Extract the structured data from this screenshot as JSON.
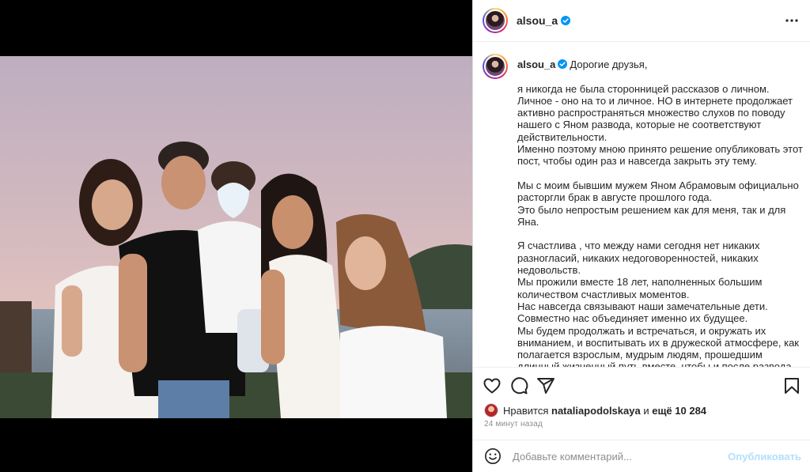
{
  "post": {
    "username": "alsou_a",
    "caption_lead": "Дорогие друзья,",
    "caption_body": "я никогда не была сторонницей рассказов о личном. Личное - оно на то и личное. НО в интернете продолжает активно распространяться множество слухов по поводу нашего с Яном развода, которые не соответствуют действительности.\nИменно поэтому мною принято решение опубликовать этот пост, чтобы один раз и навсегда закрыть эту тему.\n\nМы с моим бывшим мужем Яном Абрамовым официально расторгли брак в августе прошлого года.\nЭто было непростым решением как для меня, так и для Яна.\n\nЯ счастлива , что между нами сегодня нет никаких разногласий, никаких недоговоренностей, никаких недовольств.\nМы прожили вместе 18 лет, наполненных большим количеством счастливых моментов.\nНас навсегда связывают наши замечательные дети. Совместно нас объединяет именно их будущее.\nМы будем продолжать и встречаться, и окружать их вниманием, и воспитывать их в дружеской атмосфере, как полагается взрослым, мудрым людям, прошедшим длинный жизненный путь вместе, чтобы и после развода сохранять теплое и человеческое общение.\n\nЖизнь непростая штука. Нельзя зарекать. Жизнь прожить - не"
  },
  "likes": {
    "prefix": "Нравится",
    "user": "nataliapodolskaya",
    "middle": "и",
    "rest": "ещё 10 284"
  },
  "timestamp": "24 минут назад",
  "comment": {
    "placeholder": "Добавьте комментарий...",
    "publish_label": "Опубликовать"
  },
  "icons": {
    "more": "more-options-icon",
    "like": "heart-icon",
    "comment": "comment-icon",
    "share": "share-icon",
    "save": "bookmark-icon",
    "emoji": "emoji-icon",
    "verified": "verified-badge-icon"
  },
  "colors": {
    "verified": "#0095f6",
    "publish_disabled": "#b2dffc",
    "secondary_text": "#8e8e8e"
  }
}
